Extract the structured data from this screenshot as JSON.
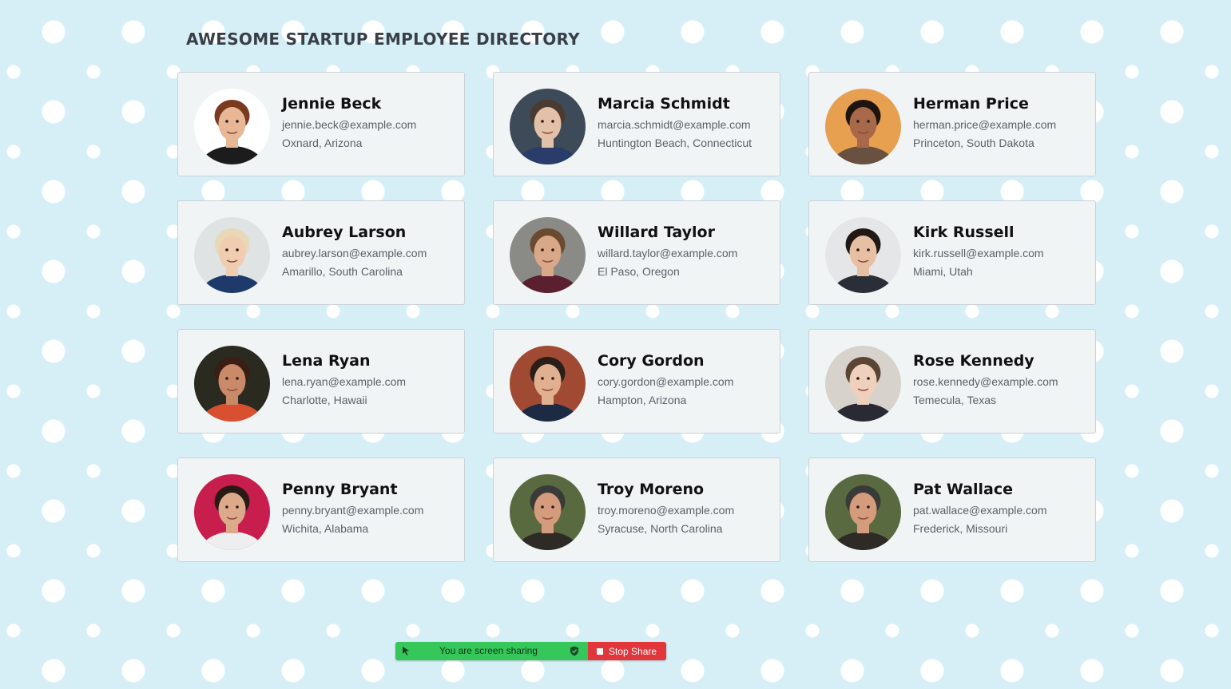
{
  "page": {
    "title": "AWESOME STARTUP EMPLOYEE DIRECTORY"
  },
  "employees": [
    {
      "name": "Jennie Beck",
      "email": "jennie.beck@example.com",
      "location": "Oxnard, Arizona",
      "avatar": {
        "bg": "#ffffff",
        "skin": "#e8b896",
        "hair": "#7a3a20",
        "shirt": "#1c1c1c"
      }
    },
    {
      "name": "Marcia Schmidt",
      "email": "marcia.schmidt@example.com",
      "location": "Huntington Beach, Connecticut",
      "avatar": {
        "bg": "#3d4a58",
        "skin": "#e3c0a8",
        "hair": "#4a3a30",
        "shirt": "#2a3c6a"
      }
    },
    {
      "name": "Herman Price",
      "email": "herman.price@example.com",
      "location": "Princeton, South Dakota",
      "avatar": {
        "bg": "#e6a050",
        "skin": "#a8684a",
        "hair": "#1e140e",
        "shirt": "#6a5040"
      }
    },
    {
      "name": "Aubrey Larson",
      "email": "aubrey.larson@example.com",
      "location": "Amarillo, South Carolina",
      "avatar": {
        "bg": "#dfe3e4",
        "skin": "#f0cdb0",
        "hair": "#e8d8b8",
        "shirt": "#1e3a6a"
      }
    },
    {
      "name": "Willard Taylor",
      "email": "willard.taylor@example.com",
      "location": "El Paso, Oregon",
      "avatar": {
        "bg": "#8a8a86",
        "skin": "#d9a888",
        "hair": "#6a4a30",
        "shirt": "#5a2030"
      }
    },
    {
      "name": "Kirk Russell",
      "email": "kirk.russell@example.com",
      "location": "Miami, Utah",
      "avatar": {
        "bg": "#e4e6e8",
        "skin": "#e7c0a4",
        "hair": "#201814",
        "shirt": "#2a2e36"
      }
    },
    {
      "name": "Lena Ryan",
      "email": "lena.ryan@example.com",
      "location": "Charlotte, Hawaii",
      "avatar": {
        "bg": "#2a2a20",
        "skin": "#c88a68",
        "hair": "#3a1e14",
        "shirt": "#d85030"
      }
    },
    {
      "name": "Cory Gordon",
      "email": "cory.gordon@example.com",
      "location": "Hampton, Arizona",
      "avatar": {
        "bg": "#a04a34",
        "skin": "#e0b090",
        "hair": "#2a1e18",
        "shirt": "#1c2a44"
      }
    },
    {
      "name": "Rose Kennedy",
      "email": "rose.kennedy@example.com",
      "location": "Temecula, Texas",
      "avatar": {
        "bg": "#d8d2cc",
        "skin": "#efd0bc",
        "hair": "#5a4434",
        "shirt": "#2a2a34"
      }
    },
    {
      "name": "Penny Bryant",
      "email": "penny.bryant@example.com",
      "location": "Wichita, Alabama",
      "avatar": {
        "bg": "#c81e4e",
        "skin": "#dcaa8a",
        "hair": "#2a1a14",
        "shirt": "#eeeeee"
      }
    },
    {
      "name": "Troy Moreno",
      "email": "troy.moreno@example.com",
      "location": "Syracuse, North Carolina",
      "avatar": {
        "bg": "#5a6a40",
        "skin": "#d49c7c",
        "hair": "#3a3a38",
        "shirt": "#2e2a26"
      }
    },
    {
      "name": "Pat Wallace",
      "email": "pat.wallace@example.com",
      "location": "Frederick, Missouri",
      "avatar": {
        "bg": "#5a6a40",
        "skin": "#d49c7c",
        "hair": "#3a3a38",
        "shirt": "#2e2a26"
      }
    }
  ],
  "screen_share": {
    "message": "You are screen sharing",
    "stop_label": "Stop Share",
    "colors": {
      "sharing": "#35c759",
      "stop": "#e0363c"
    }
  },
  "colors": {
    "background": "#d6eff6",
    "card": "#f1f4f5",
    "card_border": "#c9d2d6"
  }
}
